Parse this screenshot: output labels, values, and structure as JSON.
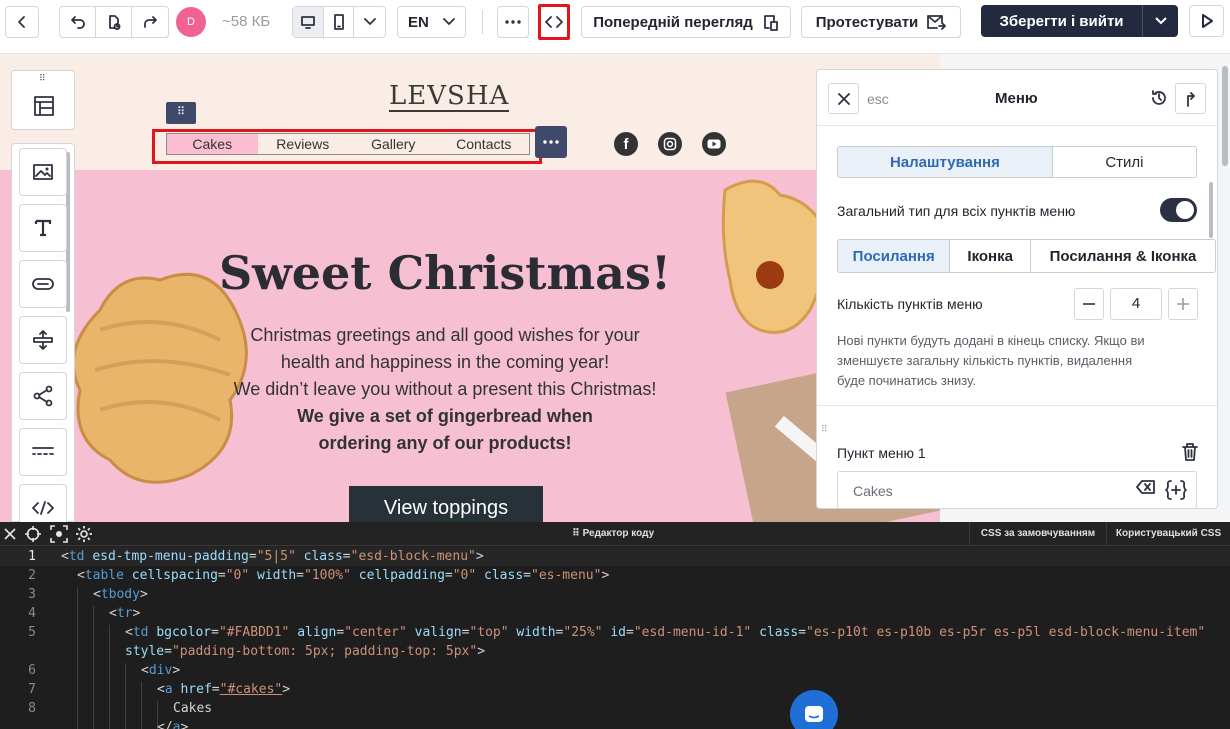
{
  "toolbar": {
    "size_label": "~58 КБ",
    "avatar_letter": "D",
    "language": "EN",
    "preview_label": "Попередній перегляд",
    "test_label": "Протестувати",
    "save_label": "Зберегти і вийти"
  },
  "email": {
    "logo": "LEVSHA",
    "menu_items": [
      "Cakes",
      "Reviews",
      "Gallery",
      "Contacts"
    ],
    "hero_title": "Sweet Christmas!",
    "hero_lines": [
      "Christmas greetings and all good wishes for your",
      "health and happiness in the coming year!",
      "We didn’t leave you without a present this Christmas!"
    ],
    "hero_bold_lines": [
      "We give a set of gingerbread when",
      "ordering any of our products!"
    ],
    "cta_label": "View toppings",
    "colors": {
      "hero_bg": "#f7bfd2",
      "menu_active": "#FABDD1",
      "cta_bg": "#263238"
    }
  },
  "panel": {
    "esc_label": "esc",
    "title": "Меню",
    "tabs": [
      "Налаштування",
      "Стилі"
    ],
    "common_type_label": "Загальний тип для всіх пунктів меню",
    "type_options": [
      "Посилання",
      "Іконка",
      "Посилання & Іконка"
    ],
    "count_label": "Кількість пунктів меню",
    "count_value": "4",
    "count_hint": [
      "Нові пункти будуть додані в кінець списку. Якщо ви",
      "зменшуєте загальну кількість пунктів, видалення",
      "буде починатись знизу."
    ],
    "item_label": "Пункт меню 1",
    "item_value": "Cakes"
  },
  "editor": {
    "title": "Редактор коду",
    "css_default_tab": "CSS за замовчуванням",
    "css_custom_tab": "Користувацький CSS",
    "line_numbers": [
      "1",
      "2",
      "3",
      "4",
      "5",
      "",
      "6",
      "7",
      "8",
      ""
    ]
  }
}
